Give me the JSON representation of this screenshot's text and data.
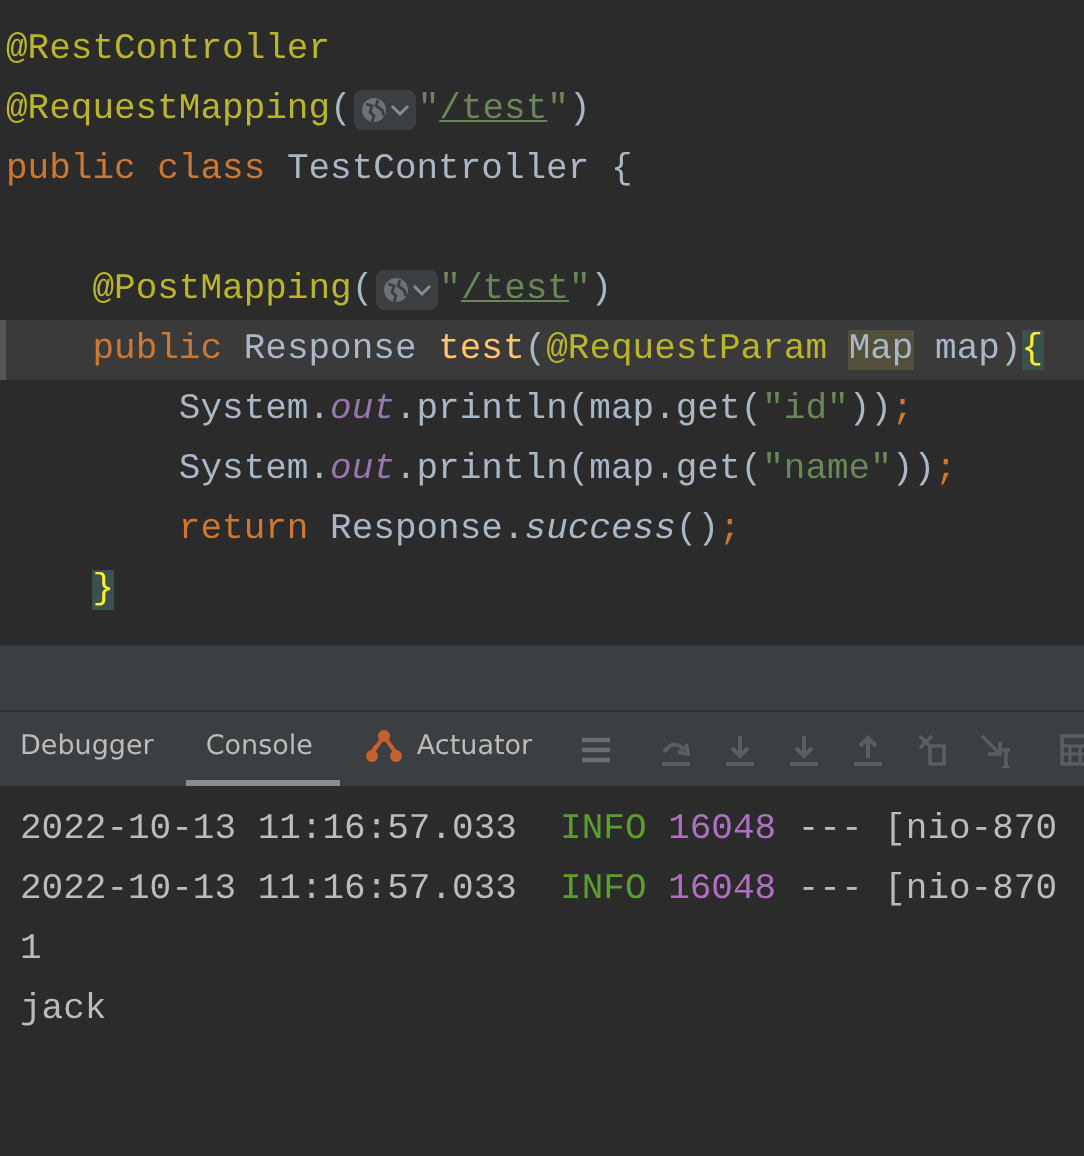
{
  "editor": {
    "lines": [
      {
        "current": false,
        "tokens": [
          {
            "kind": "annotation",
            "text": "@RestController"
          }
        ]
      },
      {
        "current": false,
        "tokens": [
          {
            "kind": "annotation",
            "text": "@RequestMapping"
          },
          {
            "kind": "plain",
            "text": "("
          },
          {
            "kind": "globe"
          },
          {
            "kind": "string",
            "text": "\""
          },
          {
            "kind": "link",
            "text": "/test"
          },
          {
            "kind": "string",
            "text": "\""
          },
          {
            "kind": "plain",
            "text": ")"
          }
        ]
      },
      {
        "current": false,
        "tokens": [
          {
            "kind": "keyword",
            "text": "public class "
          },
          {
            "kind": "plain",
            "text": "TestController {"
          }
        ]
      },
      {
        "current": false
      },
      {
        "current": false,
        "tokens": [
          {
            "kind": "annotation",
            "text": "    @PostMapping"
          },
          {
            "kind": "plain",
            "text": "("
          },
          {
            "kind": "globe"
          },
          {
            "kind": "string",
            "text": "\""
          },
          {
            "kind": "link",
            "text": "/test"
          },
          {
            "kind": "string",
            "text": "\""
          },
          {
            "kind": "plain",
            "text": ")"
          }
        ]
      },
      {
        "current": true,
        "tokens": [
          {
            "kind": "keyword",
            "text": "    public "
          },
          {
            "kind": "plain",
            "text": "Response "
          },
          {
            "kind": "method",
            "text": "test"
          },
          {
            "kind": "plain",
            "text": "("
          },
          {
            "kind": "annotation",
            "text": "@RequestParam "
          },
          {
            "kind": "usage",
            "text": "Map"
          },
          {
            "kind": "plain",
            "text": " map)"
          },
          {
            "kind": "brace",
            "text": "{"
          }
        ]
      },
      {
        "current": false,
        "tokens": [
          {
            "kind": "plain",
            "text": "        System."
          },
          {
            "kind": "field",
            "text": "out"
          },
          {
            "kind": "plain",
            "text": ".println(map.get("
          },
          {
            "kind": "string",
            "text": "\"id\""
          },
          {
            "kind": "plain",
            "text": "))"
          },
          {
            "kind": "keyword",
            "text": ";"
          }
        ]
      },
      {
        "current": false,
        "tokens": [
          {
            "kind": "plain",
            "text": "        System."
          },
          {
            "kind": "field",
            "text": "out"
          },
          {
            "kind": "plain",
            "text": ".println(map.get("
          },
          {
            "kind": "string",
            "text": "\"name\""
          },
          {
            "kind": "plain",
            "text": "))"
          },
          {
            "kind": "keyword",
            "text": ";"
          }
        ]
      },
      {
        "current": false,
        "tokens": [
          {
            "kind": "keyword",
            "text": "        return "
          },
          {
            "kind": "plain",
            "text": "Response."
          },
          {
            "kind": "static",
            "text": "success"
          },
          {
            "kind": "plain",
            "text": "()"
          },
          {
            "kind": "keyword",
            "text": ";"
          }
        ]
      },
      {
        "current": false,
        "tokens": [
          {
            "kind": "brace",
            "text": "    }"
          }
        ]
      }
    ]
  },
  "tool_window": {
    "tabs": [
      {
        "label": "Debugger",
        "selected": false,
        "kind": "plain"
      },
      {
        "label": "Console",
        "selected": true,
        "kind": "plain"
      },
      {
        "label": "Actuator",
        "selected": false,
        "kind": "actuator"
      }
    ],
    "toolbar": [
      {
        "kind": "menu"
      },
      {
        "kind": "step-over"
      },
      {
        "kind": "step-into"
      },
      {
        "kind": "step-into"
      },
      {
        "kind": "step-out"
      },
      {
        "kind": "drop-frame"
      },
      {
        "kind": "run-to-cursor"
      },
      {
        "kind": "evaluate"
      }
    ]
  },
  "console": {
    "lines": [
      {
        "tokens": [
          {
            "kind": "plain",
            "text": "2022-10-13 11:16:57.033  "
          },
          {
            "kind": "info",
            "text": "INFO "
          },
          {
            "kind": "pid",
            "text": "16048"
          },
          {
            "kind": "plain",
            "text": " --- [nio-870"
          }
        ]
      },
      {
        "tokens": [
          {
            "kind": "plain",
            "text": "2022-10-13 11:16:57.033  "
          },
          {
            "kind": "info",
            "text": "INFO "
          },
          {
            "kind": "pid",
            "text": "16048"
          },
          {
            "kind": "plain",
            "text": " --- [nio-870"
          }
        ]
      },
      {
        "tokens": [
          {
            "kind": "plain",
            "text": "1"
          }
        ]
      },
      {
        "tokens": [
          {
            "kind": "plain",
            "text": "jack"
          }
        ]
      }
    ]
  }
}
